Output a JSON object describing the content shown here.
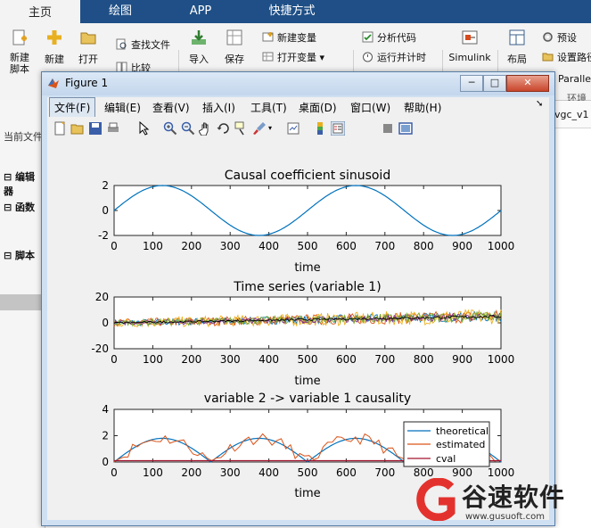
{
  "ribbon": {
    "tabs": [
      "主页",
      "绘图",
      "APP",
      "快捷方式"
    ],
    "buttons": {
      "new_script": "新建\n脚本",
      "new": "新建",
      "open": "打开",
      "find_files": "查找文件",
      "compare": "比较",
      "import": "导入",
      "save": "保存",
      "new_variable": "新建变量",
      "open_variable": "打开变量",
      "analyze_code": "分析代码",
      "run_and_time": "运行并计时",
      "simulink": "Simulink",
      "layout": "布局",
      "preferences": "预设",
      "set_path": "设置路径",
      "parallel": "Paralle",
      "environment": "环境"
    }
  },
  "left_panel": {
    "current_folder": "当前文件",
    "editor": "编辑器",
    "functions": "函数",
    "scripts": "脚本"
  },
  "right_fragment": "vgc_v1",
  "figure": {
    "title": "Figure 1",
    "menus": [
      "文件(F)",
      "编辑(E)",
      "查看(V)",
      "插入(I)",
      "工具(T)",
      "桌面(D)",
      "窗口(W)",
      "帮助(H)"
    ]
  },
  "watermark": {
    "brand": "谷速软件",
    "url": "www.gusuoft.com"
  },
  "chart_data": [
    {
      "type": "line",
      "title": "Causal coefficient sinusoid",
      "xlabel": "time",
      "ylabel": "",
      "xlim": [
        0,
        1000
      ],
      "ylim": [
        -2,
        2
      ],
      "xticks": [
        0,
        100,
        200,
        300,
        400,
        500,
        600,
        700,
        800,
        900,
        1000
      ],
      "yticks": [
        -2,
        0,
        2
      ],
      "series": [
        {
          "color": "#0072bd",
          "formula": "2*sin(2*pi*t/500)"
        }
      ]
    },
    {
      "type": "line",
      "title": "Time series (variable 1)",
      "xlabel": "time",
      "ylabel": "",
      "xlim": [
        0,
        1000
      ],
      "ylim": [
        -20,
        20
      ],
      "xticks": [
        0,
        100,
        200,
        300,
        400,
        500,
        600,
        700,
        800,
        900,
        1000
      ],
      "yticks": [
        -20,
        0,
        20
      ],
      "series": [
        {
          "color": "#0072bd",
          "amplitude": 4
        },
        {
          "color": "#d95319",
          "amplitude": 5
        },
        {
          "color": "#edb120",
          "amplitude": 6
        },
        {
          "color": "#7e2f8e",
          "amplitude": 3
        },
        {
          "color": "#77ac30",
          "amplitude": 4
        },
        {
          "color": "#000000",
          "amplitude": 1
        }
      ]
    },
    {
      "type": "line",
      "title": "variable 2 -> variable 1 causality",
      "xlabel": "time",
      "ylabel": "",
      "xlim": [
        0,
        1000
      ],
      "ylim": [
        0,
        4
      ],
      "xticks": [
        0,
        100,
        200,
        300,
        400,
        500,
        600,
        700,
        800,
        900,
        1000
      ],
      "yticks": [
        0,
        2,
        4
      ],
      "legend_position": "bottom-right",
      "series": [
        {
          "name": "theoretical",
          "color": "#0072bd"
        },
        {
          "name": "estimated",
          "color": "#d95319"
        },
        {
          "name": "cval",
          "color": "#a2142f",
          "value": 0.1
        }
      ]
    }
  ]
}
